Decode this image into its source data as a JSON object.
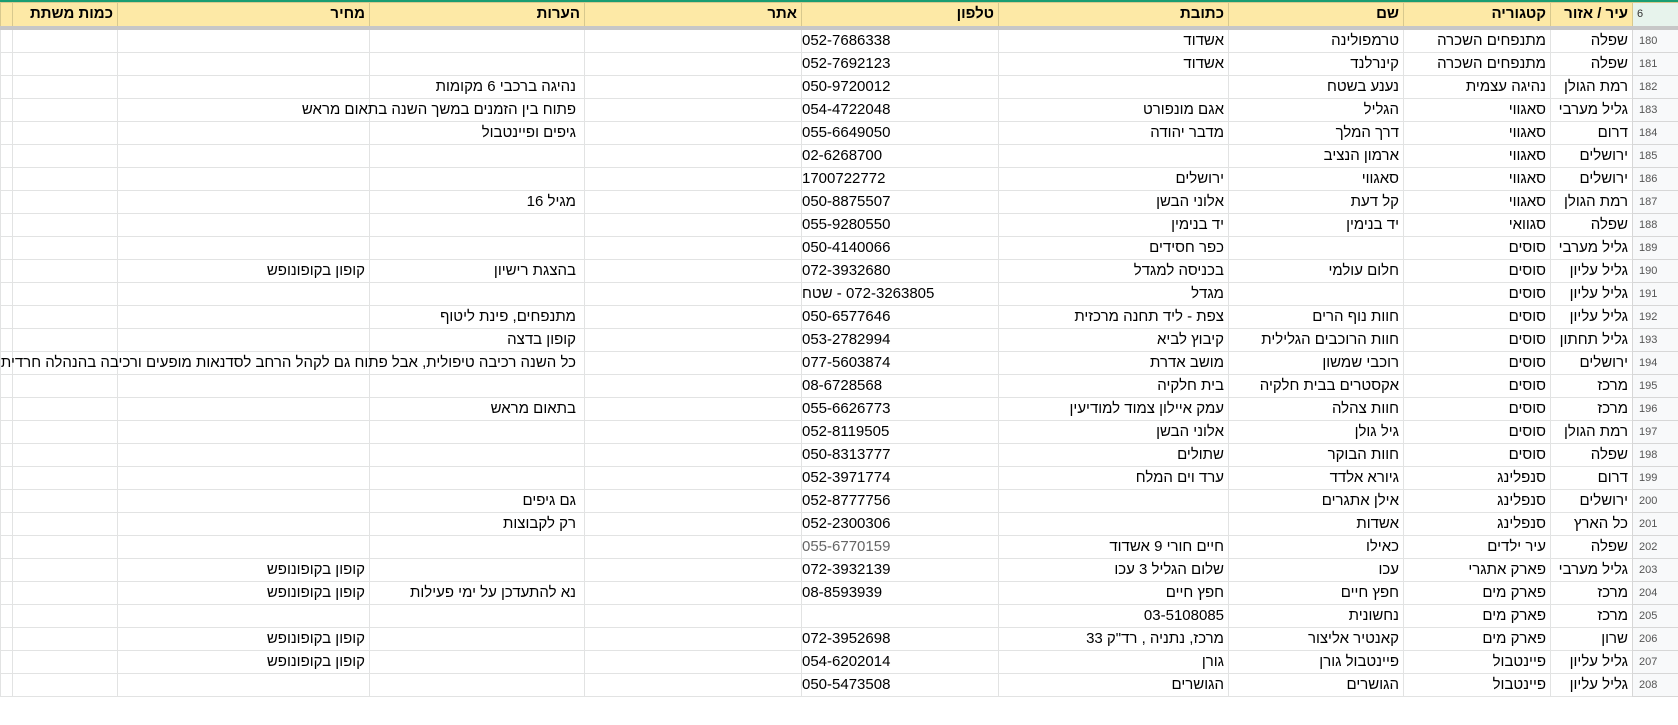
{
  "header": {
    "row_number": "6",
    "columns": [
      "עיר / אזור",
      "קטגוריה",
      "שם",
      "כתובת",
      "טלפון",
      "אתר",
      "הערות",
      "מחיר",
      "כמות משתת",
      ""
    ]
  },
  "rows": [
    {
      "n": "180",
      "city": "שפלה",
      "cat": "מתנפחים השכרה",
      "name": "טרמפולינה",
      "addr": "אשדוד",
      "phone": "052-7686338",
      "site": "",
      "notes": "",
      "price": "",
      "qty": ""
    },
    {
      "n": "181",
      "city": "שפלה",
      "cat": "מתנפחים השכרה",
      "name": "קינרלנד",
      "addr": "אשדוד",
      "phone": "052-7692123",
      "site": "",
      "notes": "",
      "price": "",
      "qty": ""
    },
    {
      "n": "182",
      "city": "רמת הגולן",
      "cat": "נהיגה עצמית",
      "name": "נענע בשטח",
      "addr": "",
      "phone": "050-9720012",
      "site": "",
      "notes": "נהיגה ברכבי 6 מקומות",
      "price": "",
      "qty": ""
    },
    {
      "n": "183",
      "city": "גליל מערבי",
      "cat": "סאגווי",
      "name": "הגליל",
      "addr": "אגם מונפורט",
      "phone": "054-4722048",
      "site": "",
      "notes": "פתוח בין הזמנים במשך השנה בתאום מראש",
      "price": "",
      "qty": ""
    },
    {
      "n": "184",
      "city": "דרום",
      "cat": "סאגווי",
      "name": "דרך המלך",
      "addr": "מדבר יהודה",
      "phone": "055-6649050",
      "site": "",
      "notes": "גיפים ופיינטבול",
      "price": "",
      "qty": ""
    },
    {
      "n": "185",
      "city": "ירושלים",
      "cat": "סאגווי",
      "name": "ארמון הנציב",
      "addr": "",
      "phone": "02-6268700",
      "site": "",
      "notes": "",
      "price": "",
      "qty": ""
    },
    {
      "n": "186",
      "city": "ירושלים",
      "cat": "סאגווי",
      "name": "סאגווי",
      "addr": "ירושלים",
      "phone": "1700722772",
      "site": "",
      "notes": "",
      "price": "",
      "qty": ""
    },
    {
      "n": "187",
      "city": "רמת הגולן",
      "cat": "סאגווי",
      "name": "קל דעת",
      "addr": "אלוני הבשן",
      "phone": "050-8875507",
      "site": "",
      "notes": "מגיל 16",
      "price": "",
      "qty": ""
    },
    {
      "n": "188",
      "city": "שפלה",
      "cat": "סגוואי",
      "name": "יד בנימין",
      "addr": "יד בנימין",
      "phone": "055-9280550",
      "site": "",
      "notes": "",
      "price": "",
      "qty": ""
    },
    {
      "n": "189",
      "city": "גליל מערבי",
      "cat": "סוסים",
      "name": "",
      "addr": "כפר חסידים",
      "phone": "050-4140066",
      "site": "",
      "notes": "",
      "price": "",
      "qty": ""
    },
    {
      "n": "190",
      "city": "גליל עליון",
      "cat": "סוסים",
      "name": "חלום עולמי",
      "addr": "בכניסה למגדל",
      "phone": "072-3932680",
      "site": "",
      "notes": "בהצגת רישיון",
      "price": "קופון בקופונופש",
      "qty": ""
    },
    {
      "n": "191",
      "city": "גליל עליון",
      "cat": "סוסים",
      "name": "",
      "addr": "מגדל",
      "phone": "072-3263805 - שטח",
      "site": "",
      "notes": "",
      "price": "",
      "qty": ""
    },
    {
      "n": "192",
      "city": "גליל עליון",
      "cat": "סוסים",
      "name": "חוות נוף הרים",
      "addr": "צפת - ליד תחנה מרכזית",
      "phone": "050-6577646",
      "site": "",
      "notes": "מתנפחים, פינת ליטוף",
      "price": "",
      "qty": ""
    },
    {
      "n": "193",
      "city": "גליל תחתון",
      "cat": "סוסים",
      "name": "חוות הרוכבים הגלילית",
      "addr": "קיבוץ לביא",
      "phone": "053-2782994",
      "site": "",
      "notes": "קופון בדצה",
      "price": "",
      "qty": ""
    },
    {
      "n": "194",
      "city": "ירושלים",
      "cat": "סוסים",
      "name": "רוכבי שמשון",
      "addr": "מושב אדרת",
      "phone": "077-5603874",
      "site": "",
      "notes": "כל השנה רכיבה טיפולית, אבל פתוח גם לקהל הרחב לסדנאות מופעים ורכיבה בהנהלה חרדית מקצועית",
      "price": "",
      "qty": ""
    },
    {
      "n": "195",
      "city": "מרכז",
      "cat": "סוסים",
      "name": "אקסטרים בבית חלקיה",
      "addr": "בית חלקיה",
      "phone": "08-6728568",
      "site": "",
      "notes": "",
      "price": "",
      "qty": ""
    },
    {
      "n": "196",
      "city": "מרכז",
      "cat": "סוסים",
      "name": "חוות צהלה",
      "addr": "עמק איילון צמוד למודיעין",
      "phone": "055-6626773",
      "site": "",
      "notes": "בתאום מראש",
      "price": "",
      "qty": ""
    },
    {
      "n": "197",
      "city": "רמת הגולן",
      "cat": "סוסים",
      "name": "גיל גולן",
      "addr": "אלוני הבשן",
      "phone": "052-8119505",
      "site": "",
      "notes": "",
      "price": "",
      "qty": ""
    },
    {
      "n": "198",
      "city": "שפלה",
      "cat": "סוסים",
      "name": "חוות הבוקר",
      "addr": "שתולים",
      "phone": "050-8313777",
      "site": "",
      "notes": "",
      "price": "",
      "qty": ""
    },
    {
      "n": "199",
      "city": "דרום",
      "cat": "סנפלינג",
      "name": "גיורא אלדד",
      "addr": "ערד וים המלח",
      "phone": "052-3971774",
      "site": "",
      "notes": "",
      "price": "",
      "qty": ""
    },
    {
      "n": "200",
      "city": "ירושלים",
      "cat": "סנפלינג",
      "name": "אילן אתגרים",
      "addr": "",
      "phone": "052-8777756",
      "site": "",
      "notes": "גם גיפים",
      "price": "",
      "qty": ""
    },
    {
      "n": "201",
      "city": "כל הארץ",
      "cat": "סנפלינג",
      "name": "אשדות",
      "addr": "",
      "phone": "052-2300306",
      "site": "",
      "notes": "רק לקבוצות",
      "price": "",
      "qty": ""
    },
    {
      "n": "202",
      "city": "שפלה",
      "cat": "עיר ילדים",
      "name": "כאילו",
      "addr": "חיים חורי 9 אשדוד",
      "phone": "055-6770159",
      "site": "",
      "notes": "",
      "price": "",
      "qty": "",
      "muted": true
    },
    {
      "n": "203",
      "city": "גליל מערבי",
      "cat": "פארק אתגרי",
      "name": "עכו",
      "addr": "שלום הגליל 3 עכו",
      "phone": "072-3932139",
      "site": "",
      "notes": "",
      "price": "קופון בקופונופש",
      "qty": ""
    },
    {
      "n": "204",
      "city": "מרכז",
      "cat": "פארק מים",
      "name": "חפץ חיים",
      "addr": "חפץ חיים",
      "phone": "08-8593939",
      "site": "",
      "notes": "נא להתעדכן על ימי פעילות",
      "price": "קופון בקופונופש",
      "qty": ""
    },
    {
      "n": "205",
      "city": "מרכז",
      "cat": "פארק מים",
      "name": "נחשונית",
      "addr": "03-5108085",
      "phone": "",
      "site": "",
      "notes": "",
      "price": "",
      "qty": ""
    },
    {
      "n": "206",
      "city": "שרון",
      "cat": "פארק מים",
      "name": "קאנטיר אליצור",
      "addr": "מרכז, נתניה , רד\"ק 33",
      "phone": "072-3952698",
      "site": "",
      "notes": "",
      "price": "קופון בקופונופש",
      "qty": ""
    },
    {
      "n": "207",
      "city": "גליל עליון",
      "cat": "פיינטבול",
      "name": "פיינטבול גורן",
      "addr": "גורן",
      "phone": "054-6202014",
      "site": "",
      "notes": "",
      "price": "קופון בקופונופש",
      "qty": ""
    },
    {
      "n": "208",
      "city": "גליל עליון",
      "cat": "פיינטבול",
      "name": "הגושרים",
      "addr": "הגושרים",
      "phone": "050-5473508",
      "site": "",
      "notes": "",
      "price": "",
      "qty": ""
    }
  ]
}
